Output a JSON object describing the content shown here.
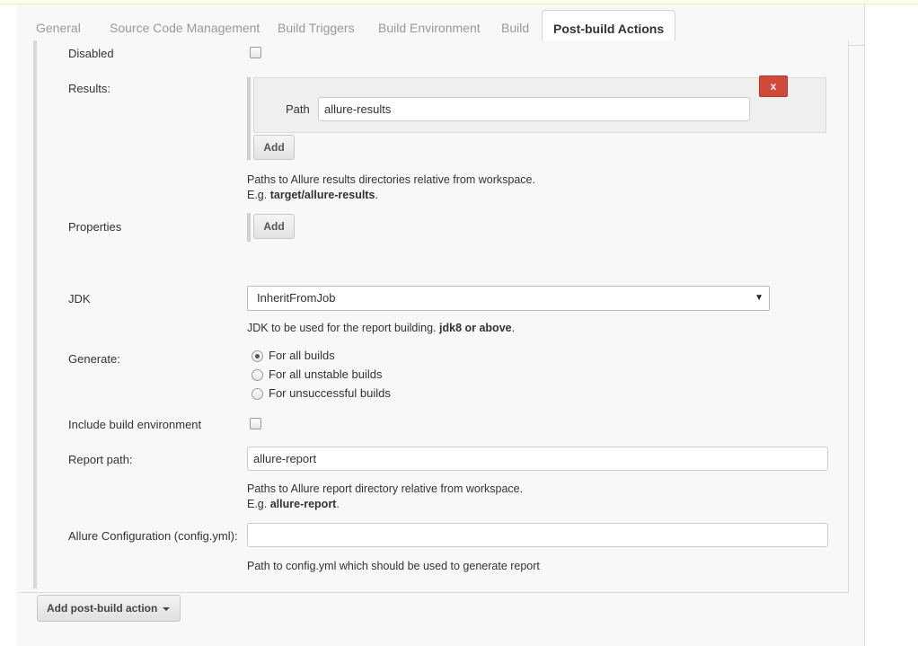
{
  "tabs": [
    {
      "label": "General"
    },
    {
      "label": "Source Code Management"
    },
    {
      "label": "Build Triggers"
    },
    {
      "label": "Build Environment"
    },
    {
      "label": "Build"
    },
    {
      "label": "Post-build Actions",
      "active": true
    }
  ],
  "form": {
    "disabled": {
      "label": "Disabled",
      "checked": false
    },
    "results": {
      "label": "Results:",
      "path_label": "Path",
      "path_value": "allure-results",
      "remove_label": "x",
      "add_label": "Add",
      "help_line1": "Paths to Allure results directories relative from workspace.",
      "help_line2_prefix": "E.g. ",
      "help_line2_bold": "target/allure-results",
      "help_line2_suffix": "."
    },
    "properties": {
      "label": "Properties",
      "add_label": "Add"
    },
    "jdk": {
      "label": "JDK",
      "selected": "InheritFromJob",
      "help_prefix": "JDK to be used for the report building. ",
      "help_bold": "jdk8 or above",
      "help_suffix": "."
    },
    "generate": {
      "label": "Generate:",
      "options": [
        {
          "label": "For all builds",
          "checked": true
        },
        {
          "label": "For all unstable builds",
          "checked": false
        },
        {
          "label": "For unsuccessful builds",
          "checked": false
        }
      ]
    },
    "include_env": {
      "label": "Include build environment",
      "checked": false
    },
    "report_path": {
      "label": "Report path:",
      "value": "allure-report",
      "help_line1": "Paths to Allure report directory relative from workspace.",
      "help_line2_prefix": "E.g. ",
      "help_line2_bold": "allure-report",
      "help_line2_suffix": "."
    },
    "config": {
      "label": "Allure Configuration (config.yml):",
      "value": "",
      "help": "Path to config.yml which should be used to generate report"
    }
  },
  "footer": {
    "add_action_label": "Add post-build action"
  },
  "colors": {
    "remove_button": "#d24939",
    "tab_inactive_text": "#999999"
  }
}
